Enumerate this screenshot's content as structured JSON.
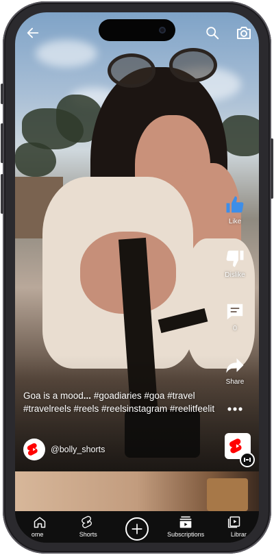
{
  "top_bar": {
    "back_icon": "arrow-left-icon",
    "search_icon": "search-icon",
    "camera_icon": "camera-icon"
  },
  "actions": {
    "like_label": "Like",
    "dislike_label": "Dislike",
    "comments_label": "0",
    "share_label": "Share",
    "more_icon": "more-vertical-icon"
  },
  "caption": {
    "lead": "Goa is a mood",
    "ellipsis": "...",
    "tags": " #goadiaries #goa #travel #travelreels #reels #reelsinstagram #reelitfeelit"
  },
  "channel": {
    "name": "@bolly_shorts"
  },
  "nav": {
    "items": [
      {
        "label": "Home",
        "display": "ome"
      },
      {
        "label": "Shorts",
        "display": "Shorts"
      },
      {
        "label": "Create",
        "display": ""
      },
      {
        "label": "Subscriptions",
        "display": "Subscriptions"
      },
      {
        "label": "Library",
        "display": "Librar"
      }
    ]
  },
  "colors": {
    "brand_red": "#ff0000",
    "like_blue": "#3e8ee8",
    "nav_bg": "#0f0f0f"
  }
}
